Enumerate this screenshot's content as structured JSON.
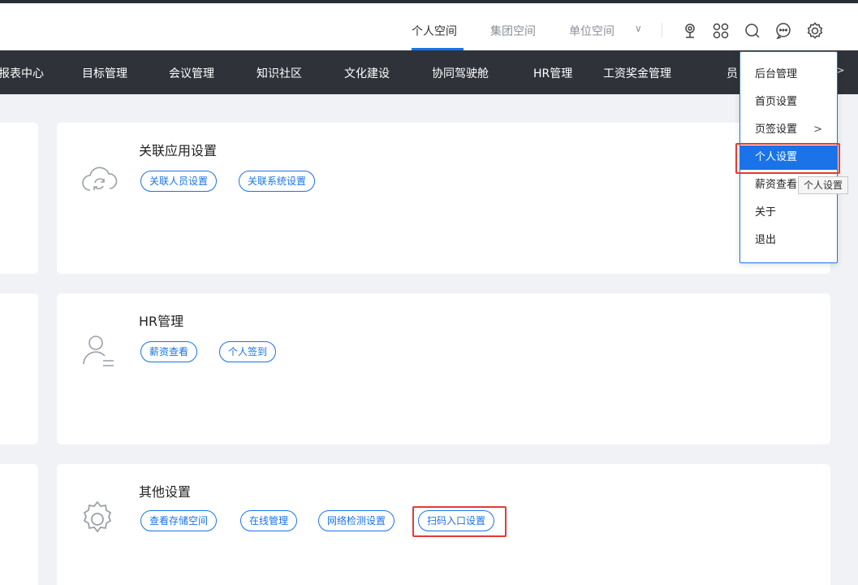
{
  "header": {
    "space_tabs": [
      "个人空间",
      "集团空间",
      "单位空间"
    ],
    "icons": [
      "webcam-icon",
      "apps-grid-icon",
      "search-icon",
      "chat-icon",
      "gear-icon"
    ]
  },
  "nav": {
    "items": [
      "报表中心",
      "目标管理",
      "会议管理",
      "知识社区",
      "文化建设",
      "协同驾驶舱",
      "HR管理",
      "工资奖金管理",
      "员"
    ],
    "more_arrow": ">"
  },
  "cards": [
    {
      "title": "关联应用设置",
      "icon": "cloud-sync-icon",
      "buttons": [
        "关联人员设置",
        "关联系统设置"
      ]
    },
    {
      "title": "HR管理",
      "icon": "user-list-icon",
      "buttons": [
        "薪资查看",
        "个人签到"
      ]
    },
    {
      "title": "其他设置",
      "icon": "gear-icon",
      "buttons": [
        "查看存储空间",
        "在线管理",
        "网络检测设置",
        "扫码入口设置"
      ]
    }
  ],
  "dropdown": {
    "items": [
      "后台管理",
      "首页设置",
      "页签设置",
      "个人设置",
      "薪资查看",
      "关于",
      "退出"
    ],
    "active_index": 3,
    "submenu_arrow": ">",
    "tooltip": "个人设置"
  },
  "colors": {
    "accent": "#1a73e8",
    "navbar": "#2f3339",
    "highlight": "#e53935",
    "background": "#f0f2f5"
  }
}
